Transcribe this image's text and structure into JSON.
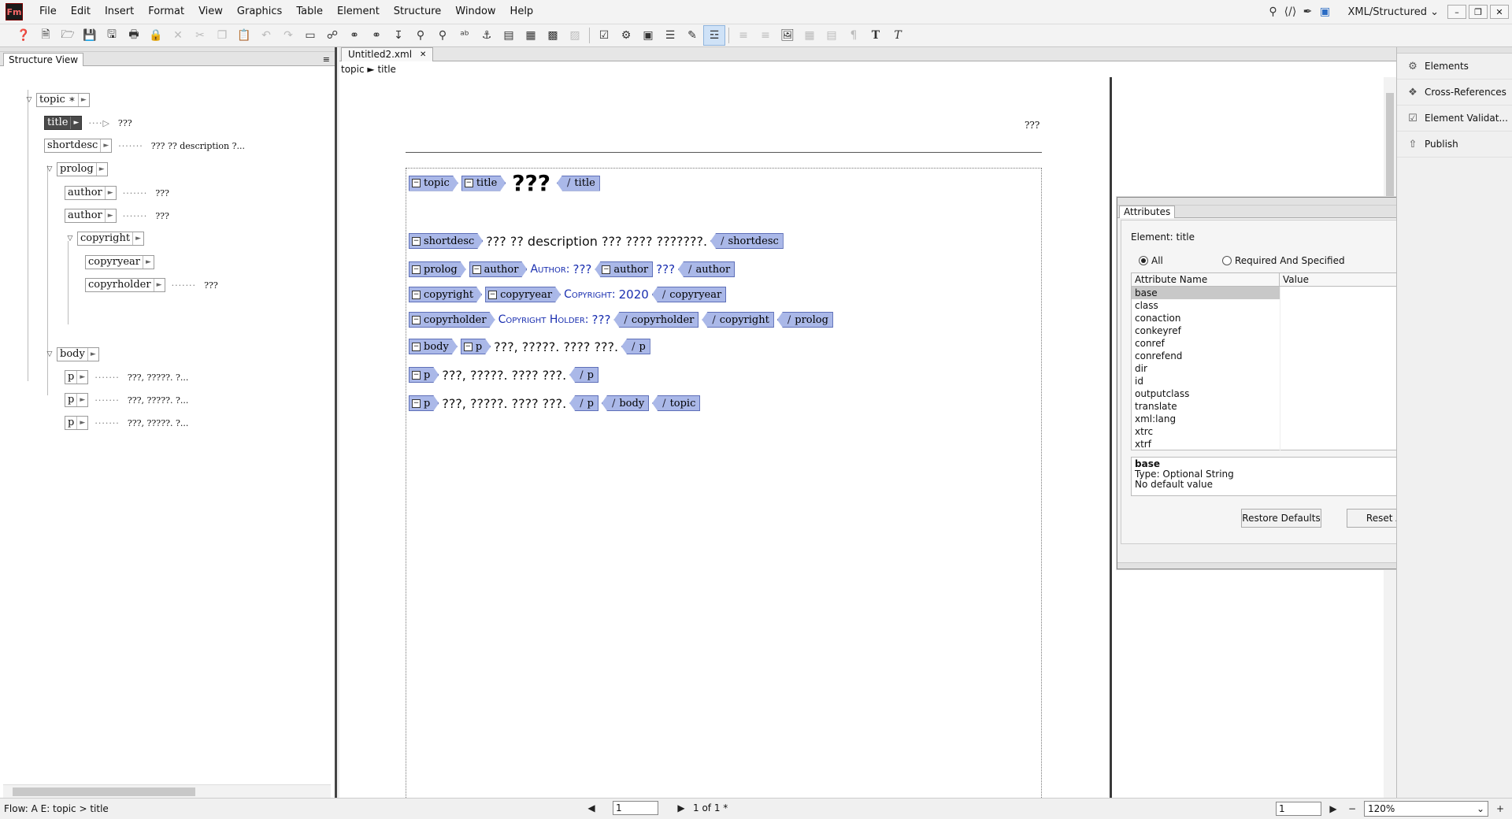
{
  "app": {
    "logo": "Fm",
    "menu": [
      "File",
      "Edit",
      "Insert",
      "Format",
      "View",
      "Graphics",
      "Table",
      "Element",
      "Structure",
      "Window",
      "Help"
    ],
    "workspace": "XML/Structured",
    "workspace_chevron": "⌄",
    "window_buttons": [
      "–",
      "❐",
      "✕"
    ]
  },
  "toolbar_icons": [
    "help-icon",
    "new-icon",
    "open-icon",
    "save-icon",
    "save-as-icon",
    "print-icon",
    "lock-icon",
    "cut-icon",
    "copy-icon",
    "paste-icon",
    "undo-icon",
    "redo-icon"
  ],
  "structure_view": {
    "tab_label": "Structure View",
    "menu_glyph": "≡",
    "nodes": {
      "topic": "topic ∗",
      "title": "title",
      "title_val": "???",
      "shortdesc": "shortdesc",
      "shortdesc_val": "??? ?? description ?...",
      "prolog": "prolog",
      "author1": "author",
      "author1_val": "???",
      "author2": "author",
      "author2_val": "???",
      "copyright": "copyright",
      "copyryear": "copyryear",
      "copyrholder": "copyrholder",
      "copyrholder_val": "???",
      "body": "body",
      "p1": "p",
      "p1_val": "???, ?????. ?...",
      "p2": "p",
      "p2_val": "???, ?????. ?...",
      "p3": "p",
      "p3_val": "???, ?????. ?..."
    },
    "dots": "·······",
    "dot_arrow": "····▷",
    "toggle": "▽",
    "arrow": "►"
  },
  "document": {
    "tab_label": "Untitled2.xml",
    "tab_close": "✕",
    "breadcrumb": "topic  ►  title",
    "header_text": "???",
    "tags": {
      "topic": "topic",
      "title": "title",
      "shortdesc": "shortdesc",
      "prolog": "prolog",
      "author": "author",
      "copyright": "copyright",
      "copyryear": "copyryear",
      "copyrholder": "copyrholder",
      "body": "body",
      "p": "p"
    },
    "slash": "/",
    "minus": "−",
    "title_text": "???",
    "shortdesc_text": "??? ?? description ??? ???? ???????.",
    "author_label": "Author:",
    "author1_val": "???",
    "author2_val": "???",
    "copyright_label": "Copyright:",
    "copyryear_val": "2020",
    "copyrholder_label": "Copyright Holder:",
    "copyrholder_val": "???",
    "p1_text": "???, ?????. ???? ???.",
    "p2_text": "???, ?????. ???? ???.",
    "p3_text": "???, ?????. ???? ???."
  },
  "attributes": {
    "tab_label": "Attributes",
    "menu_glyph": "≡",
    "top_buttons": [
      "‹‹",
      "✕"
    ],
    "element_line": "Element:  title",
    "radio_all": "All",
    "radio_required": "Required And Specified",
    "col_name": "Attribute Name",
    "col_value": "Value",
    "rows": [
      "base",
      "class",
      "conaction",
      "conkeyref",
      "conref",
      "conrefend",
      "dir",
      "id",
      "outputclass",
      "translate",
      "xml:lang",
      "xtrc",
      "xtrf"
    ],
    "scroll_up": "▲",
    "scroll_down": "▼",
    "desc_name": "base",
    "desc_type": "Type: Optional String",
    "desc_default": "No default value",
    "restore_defaults": "Restore Defaults",
    "reset_all": "Reset All"
  },
  "right_dock": {
    "items": [
      "Elements",
      "Cross-References",
      "Element Validat...",
      "Publish"
    ]
  },
  "status": {
    "flow": "Flow: A   E: topic > title",
    "page_input": "1",
    "page_of": "1 of 1 *",
    "first_page": "◀",
    "last_page": "▶",
    "right_input": "1",
    "next_icon": "▶",
    "minus": "−",
    "plus": "+",
    "zoom": "120%",
    "zoom_chevron": "⌄"
  }
}
